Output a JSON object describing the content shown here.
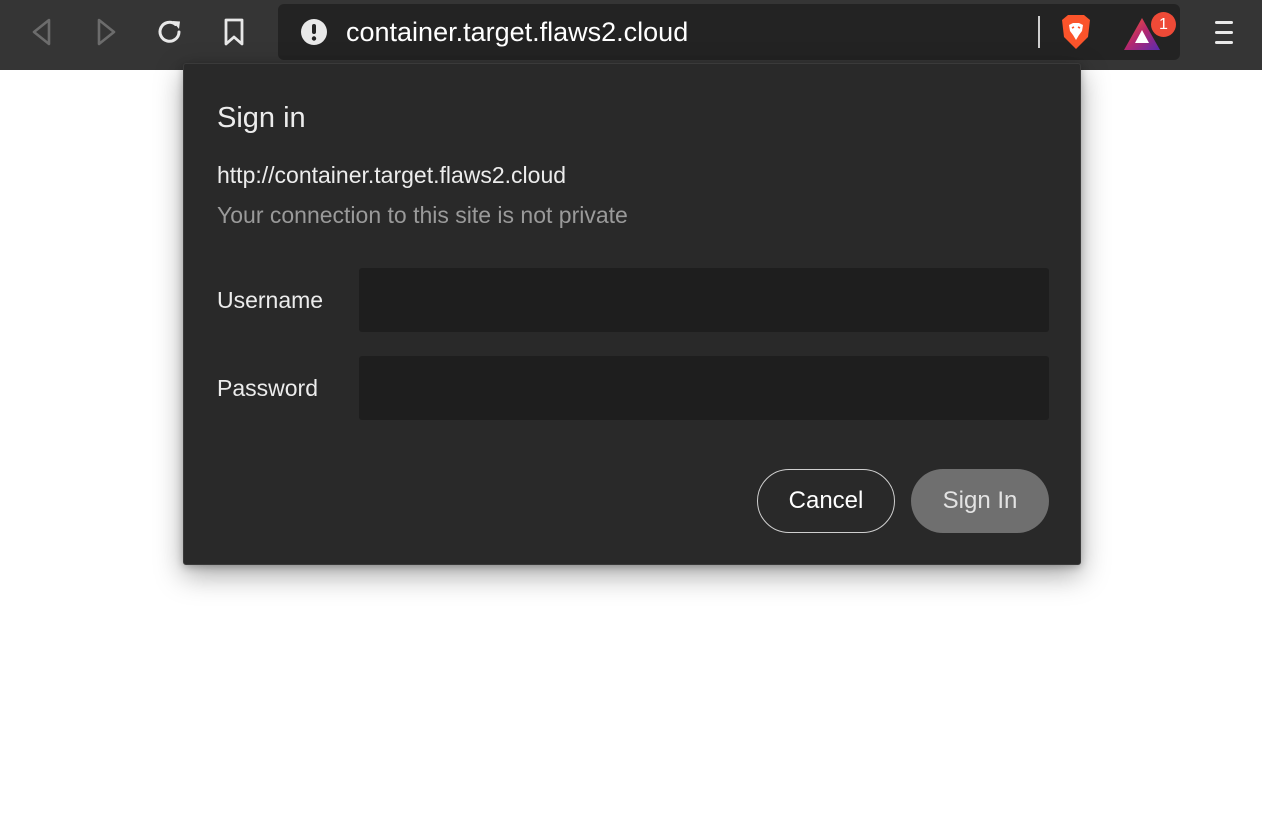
{
  "toolbar": {
    "back_icon": "back-arrow-icon",
    "forward_icon": "forward-arrow-icon",
    "reload_icon": "reload-icon",
    "bookmark_icon": "bookmark-icon",
    "address": "container.target.flaws2.cloud",
    "security_icon": "warning-icon",
    "shield_icon": "brave-lion-icon",
    "rewards_icon": "brave-rewards-icon",
    "rewards_badge": "1",
    "menu_icon": "hamburger-menu-icon"
  },
  "dialog": {
    "title": "Sign in",
    "url": "http://container.target.flaws2.cloud",
    "warning": "Your connection to this site is not private",
    "username_label": "Username",
    "username_value": "",
    "password_label": "Password",
    "password_value": "",
    "cancel_label": "Cancel",
    "signin_label": "Sign In"
  },
  "colors": {
    "toolbar_bg": "#353535",
    "omnibox_bg": "#232323",
    "dialog_bg": "#292929",
    "input_bg": "#1e1e1e",
    "brave_orange": "#fb542b",
    "badge_red": "#ee4a37"
  }
}
